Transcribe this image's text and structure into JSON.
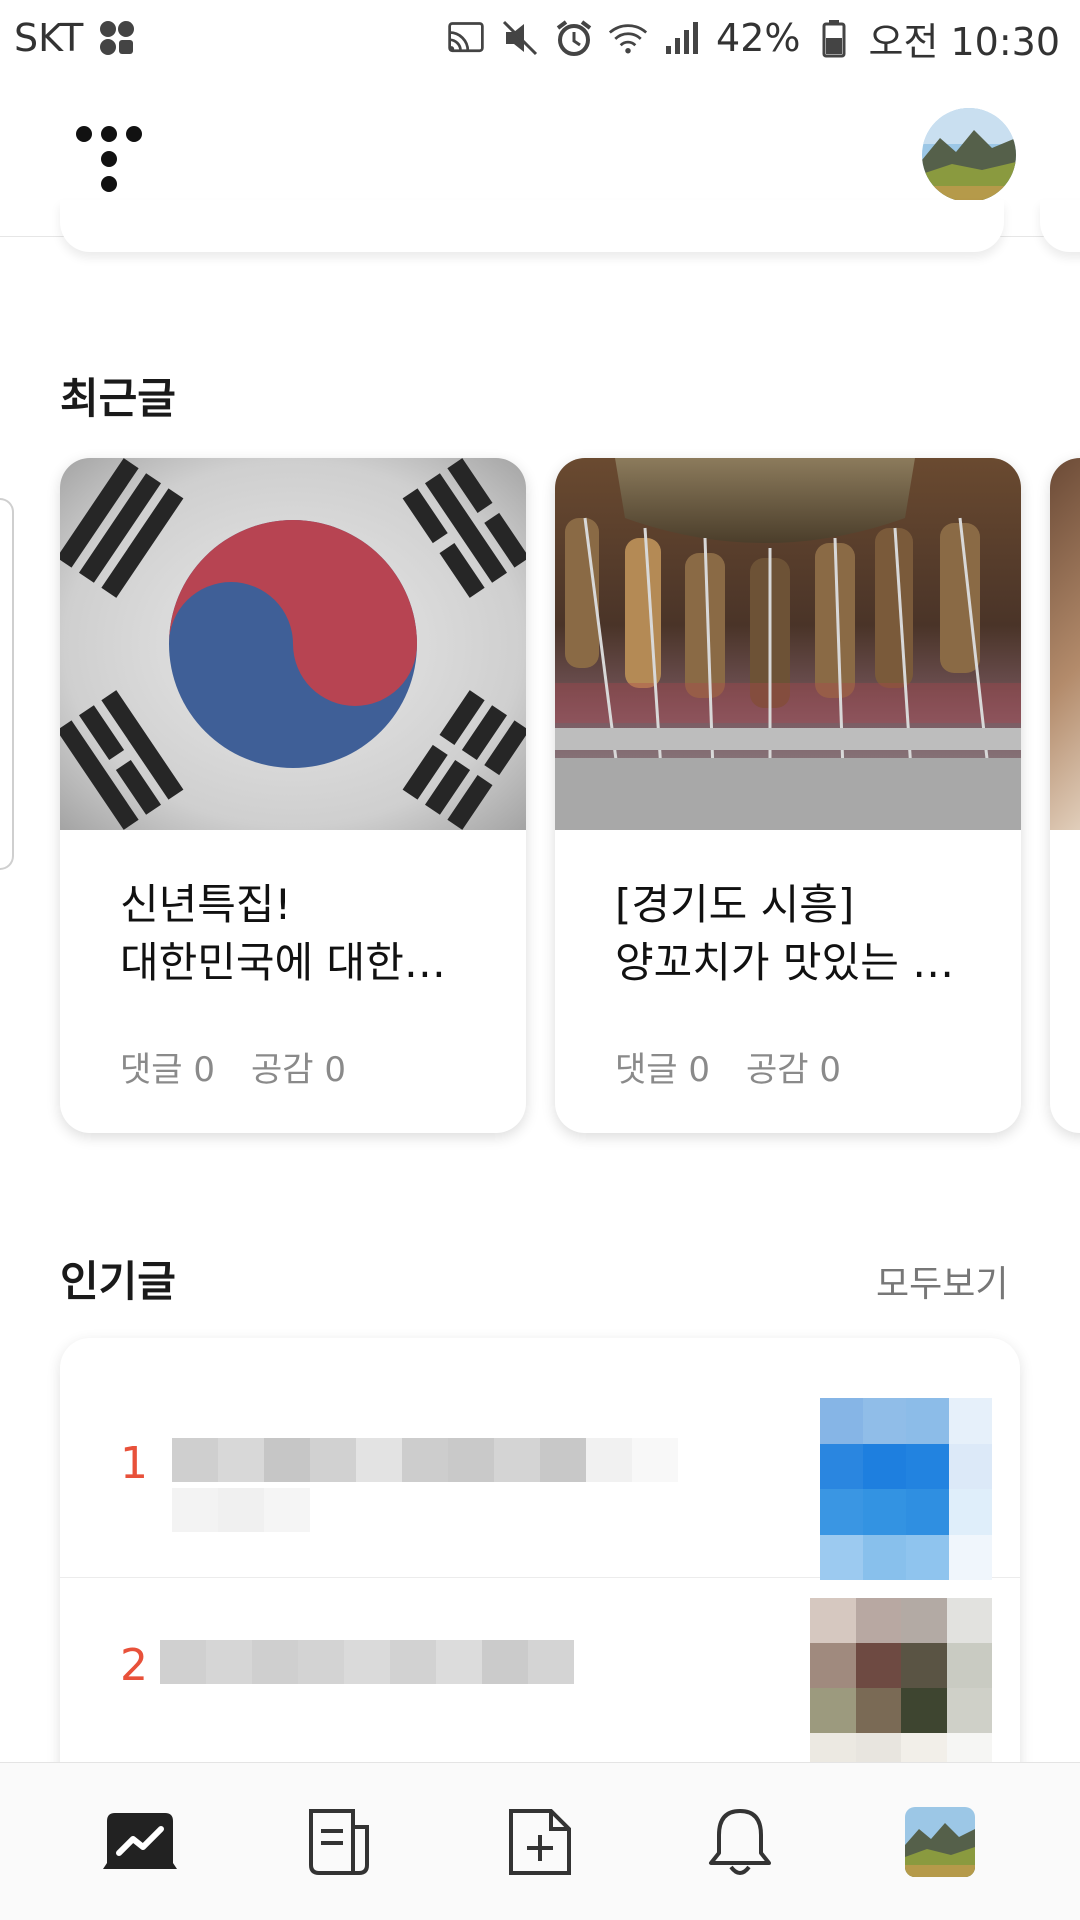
{
  "status_bar": {
    "carrier": "SKT",
    "battery": "42%",
    "time": "오전 10:30",
    "icons": [
      "cast-icon",
      "vibrate-mute-icon",
      "alarm-icon",
      "wifi-icon",
      "signal-icon",
      "battery-icon"
    ]
  },
  "header": {
    "logo_icon": "tistory-logo-icon",
    "avatar": "profile-avatar"
  },
  "recent": {
    "title": "최근글",
    "posts": [
      {
        "title_line1": "신년특집!",
        "title_line2": "대한민국에 대한…",
        "comments": "댓글 0",
        "likes": "공감 0",
        "thumbnail": "korean-flag-image"
      },
      {
        "title_line1": "[경기도 시흥]",
        "title_line2": "양꼬치가 맛있는 …",
        "comments": "댓글 0",
        "likes": "공감 0",
        "thumbnail": "lamb-skewer-image"
      }
    ]
  },
  "popular": {
    "title": "인기글",
    "see_all": "모두보기",
    "items": [
      {
        "rank": "1"
      },
      {
        "rank": "2"
      }
    ]
  },
  "bottom_nav": {
    "items": [
      "stats-icon",
      "posts-icon",
      "new-post-icon",
      "notification-icon",
      "my-blog-avatar"
    ]
  },
  "colors": {
    "accent_rank": "#e8513a",
    "text_primary": "#111111",
    "text_meta": "#8a8a8a"
  }
}
